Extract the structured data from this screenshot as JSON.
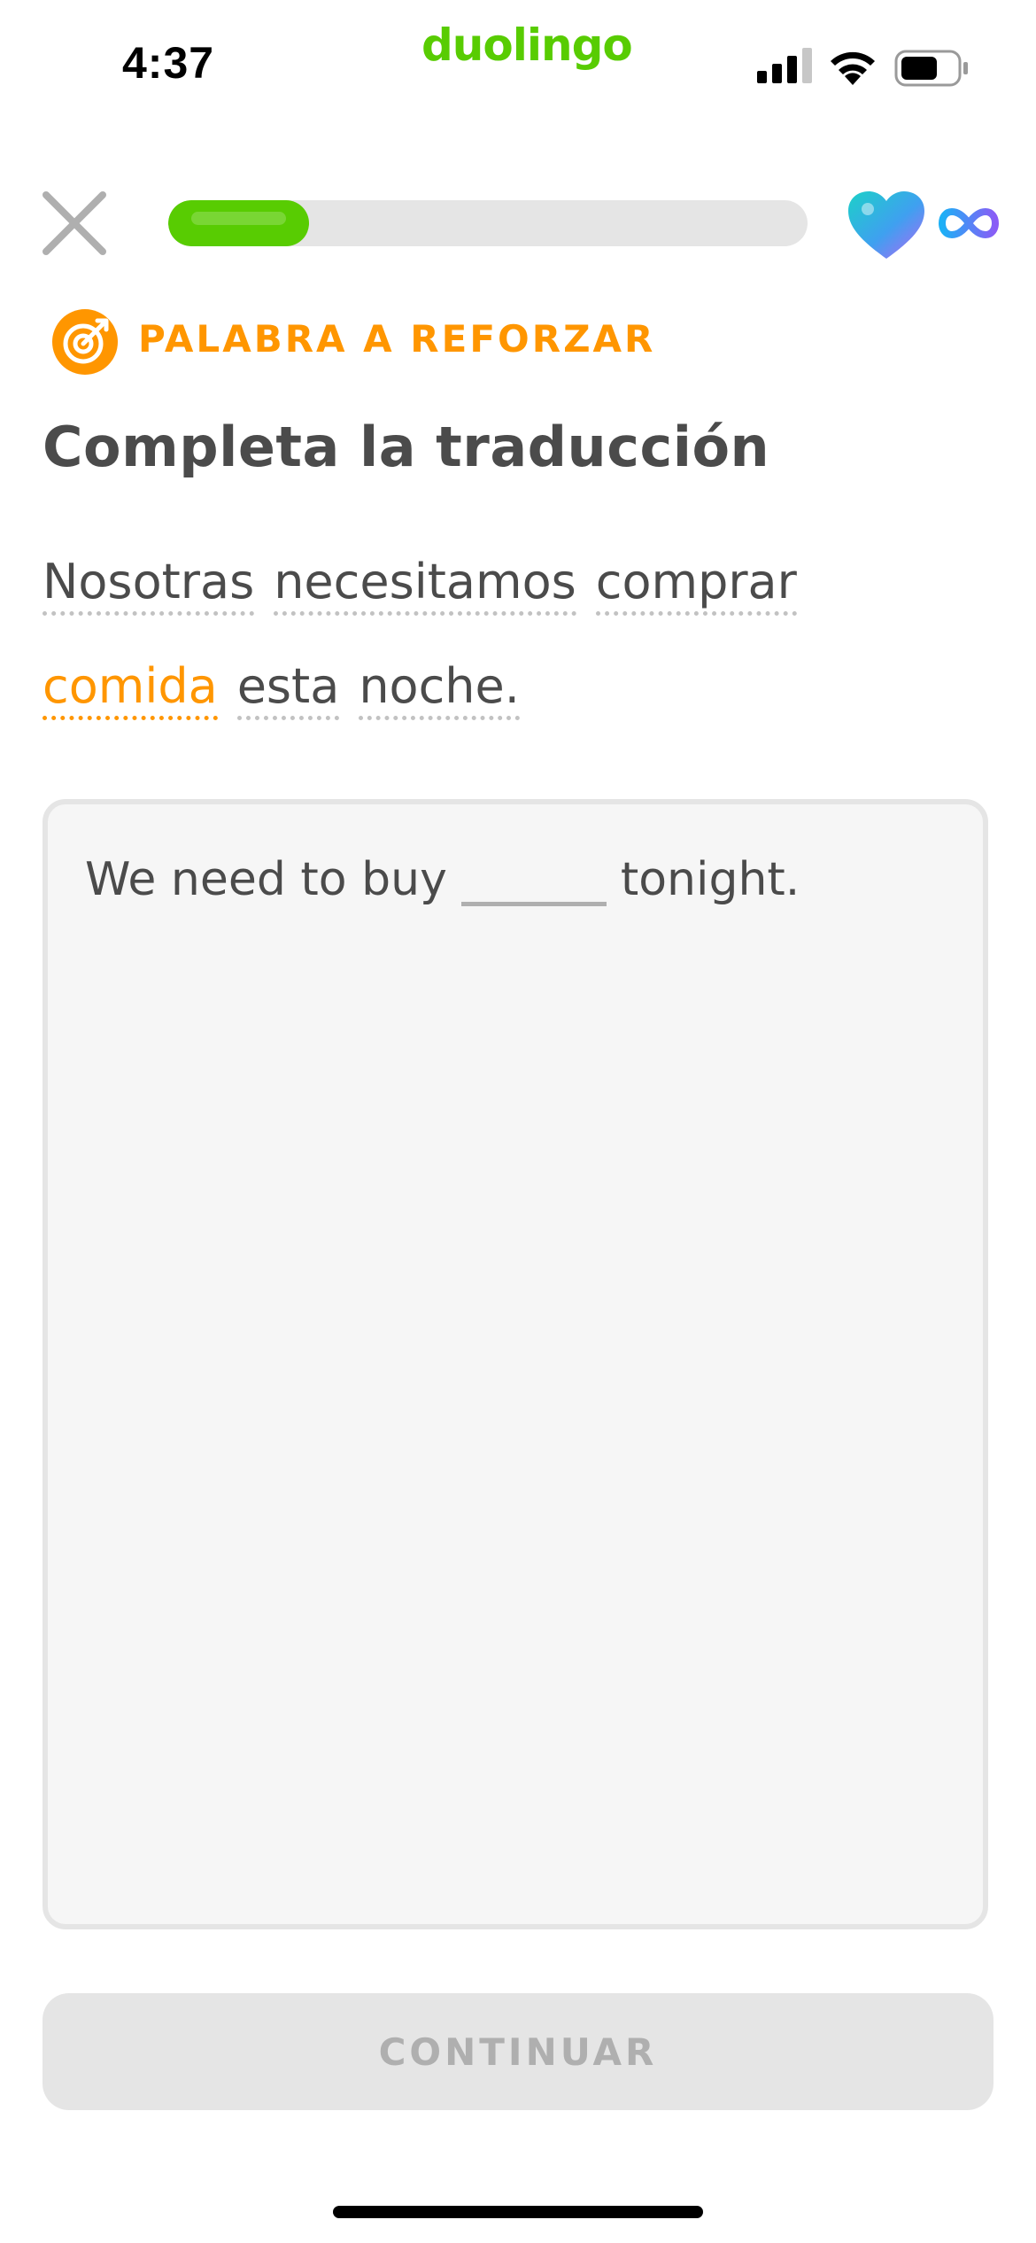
{
  "status_bar": {
    "time": "4:37",
    "app_name": "duolingo",
    "signal_icon": "cellular-signal-icon",
    "wifi_icon": "wifi-icon",
    "battery_icon": "battery-icon"
  },
  "header": {
    "close_icon": "close-icon",
    "progress_fraction": 0.22,
    "hearts_icon": "heart-icon",
    "hearts_value_icon": "infinity-icon"
  },
  "challenge": {
    "label": "PALABRA A REFORZAR",
    "label_icon": "target-icon",
    "title": "Completa la traducción",
    "prompt_words": [
      "Nosotras",
      "necesitamos",
      "comprar",
      "comida",
      "esta",
      "noche."
    ],
    "highlighted_word": "comida",
    "answer_prefix": "We need to buy",
    "answer_suffix": "tonight.",
    "answer_value": ""
  },
  "footer": {
    "continue_label": "CONTINUAR"
  },
  "colors": {
    "brand_green": "#58cc02",
    "accent_orange": "#ff9600",
    "text": "#4b4b4b",
    "disabled": "#e5e5e5"
  }
}
